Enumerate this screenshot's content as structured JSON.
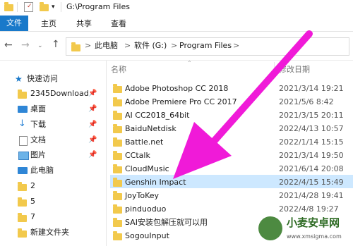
{
  "window": {
    "path_title": "G:\\Program Files"
  },
  "ribbon": {
    "tabs": [
      "文件",
      "主页",
      "共享",
      "查看"
    ]
  },
  "address": {
    "segments": [
      "此电脑",
      "软件 (G:)",
      "Program Files"
    ],
    "separators": [
      ">",
      ">",
      ">"
    ]
  },
  "nav": {
    "items": [
      {
        "label": "快速访问"
      },
      {
        "label": "2345Download"
      },
      {
        "label": "桌面"
      },
      {
        "label": "下载"
      },
      {
        "label": "文档"
      },
      {
        "label": "图片"
      },
      {
        "label": "此电脑"
      },
      {
        "label": "2"
      },
      {
        "label": "5"
      },
      {
        "label": "7"
      },
      {
        "label": "新建文件夹"
      }
    ]
  },
  "columns": {
    "name": "名称",
    "date": "修改日期"
  },
  "files": [
    {
      "name": "Adobe Photoshop CC 2018",
      "date": "2021/3/14 19:21"
    },
    {
      "name": "Adobe Premiere Pro CC 2017",
      "date": "2021/5/6 8:42"
    },
    {
      "name": "AI CC2018_64bit",
      "date": "2021/3/15 20:11"
    },
    {
      "name": "BaiduNetdisk",
      "date": "2022/4/13 10:57"
    },
    {
      "name": "Battle.net",
      "date": "2022/1/14 15:15"
    },
    {
      "name": "CCtalk",
      "date": "2021/3/14 19:50"
    },
    {
      "name": "CloudMusic",
      "date": "2021/6/14 20:08"
    },
    {
      "name": "Genshin Impact",
      "date": "2022/4/15 15:49"
    },
    {
      "name": "JoyToKey",
      "date": "2021/4/28 19:41"
    },
    {
      "name": "pinduoduo",
      "date": "2022/4/8 19:27"
    },
    {
      "name": "SAI安装包解压就可以用",
      "date": ""
    },
    {
      "name": "SogouInput",
      "date": ""
    }
  ],
  "watermark": {
    "text": "小麦安卓网",
    "url": "www.xmsigma.com"
  },
  "colors": {
    "accent": "#1979ca",
    "selection": "#cde8ff",
    "arrow": "#f01ad8",
    "folder": "#f2c94c"
  }
}
